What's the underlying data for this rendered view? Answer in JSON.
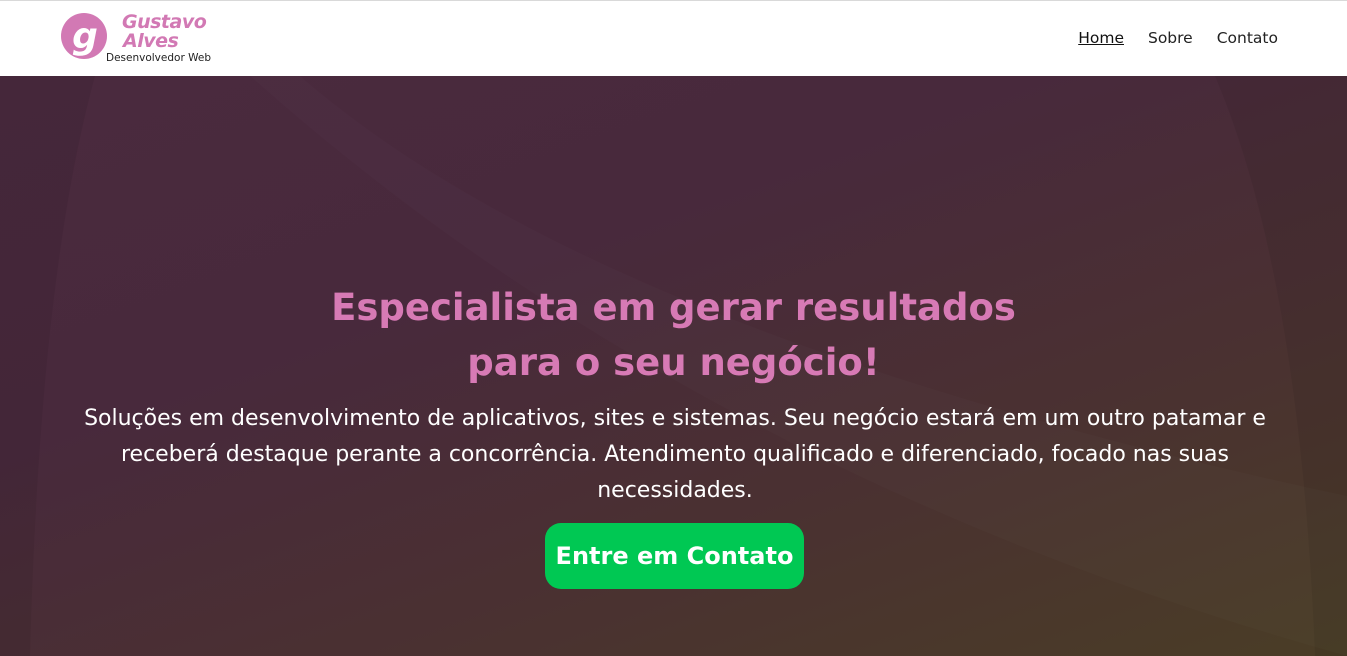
{
  "brand": {
    "mark_letter": "g",
    "name_line1": "Gustavo",
    "name_line2": "Alves",
    "tagline": "Desenvolvedor Web",
    "color": "#d279b4"
  },
  "nav": {
    "items": [
      {
        "label": "Home",
        "active": true
      },
      {
        "label": "Sobre",
        "active": false
      },
      {
        "label": "Contato",
        "active": false
      }
    ]
  },
  "hero": {
    "title_line1": "Especialista em gerar resultados",
    "title_line2": "para o seu negócio!",
    "description": "Soluções em desenvolvimento de aplicativos, sites e sistemas. Seu negócio estará em um outro patamar e receberá destaque perante a concorrência. Atendimento qualificado e diferenciado, focado nas suas necessidades.",
    "cta_label": "Entre em Contato",
    "colors": {
      "title": "#d77ab5",
      "cta_background": "#00c853",
      "background_top": "#48293c",
      "background_bottom": "#4a3d26"
    }
  }
}
